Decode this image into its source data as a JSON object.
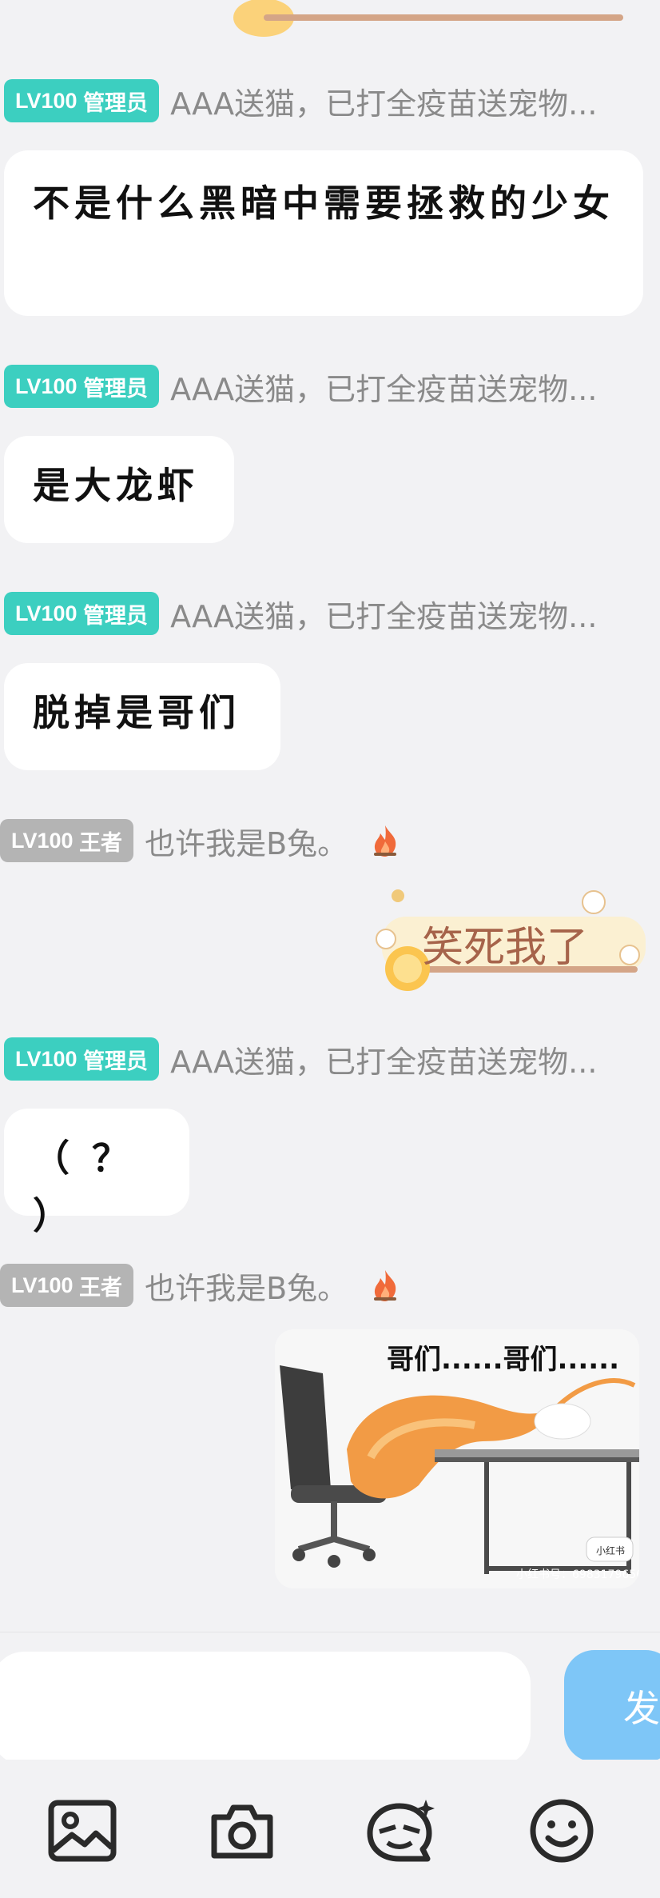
{
  "top_sticker": {
    "icon": "sticker-fragment"
  },
  "messages": [
    {
      "sender": {
        "level": "LV100",
        "role": "管理员",
        "name": "AAA送猫，已打全疫苗送宠物..."
      },
      "text": "不是什么黑暗中需要拯救的少女"
    },
    {
      "sender": {
        "level": "LV100",
        "role": "管理员",
        "name": "AAA送猫，已打全疫苗送宠物..."
      },
      "text": "是大龙虾"
    },
    {
      "sender": {
        "level": "LV100",
        "role": "管理员",
        "name": "AAA送猫，已打全疫苗送宠物..."
      },
      "text": "脱掉是哥们"
    },
    {
      "sender": {
        "level": "LV100",
        "role": "王者",
        "name": "也许我是B兔。"
      },
      "sticker_text": "笑死我了"
    },
    {
      "sender": {
        "level": "LV100",
        "role": "管理员",
        "name": "AAA送猫，已打全疫苗送宠物..."
      },
      "text": "（ ？ ）"
    },
    {
      "sender": {
        "level": "LV100",
        "role": "王者",
        "name": "也许我是B兔。"
      },
      "image_caption": "哥们......哥们......",
      "image_watermark": "小红书号：6983179656",
      "image_logo": "小红书"
    }
  ],
  "composer": {
    "send_label": "发"
  },
  "toolbar": {
    "icons": [
      "image-icon",
      "camera-icon",
      "sticker-face-icon",
      "emoji-icon"
    ]
  },
  "colors": {
    "admin_badge": "#3ccfc0",
    "king_badge": "#b4b4b4",
    "send_button": "#7ec6f7",
    "background": "#f2f2f4"
  }
}
